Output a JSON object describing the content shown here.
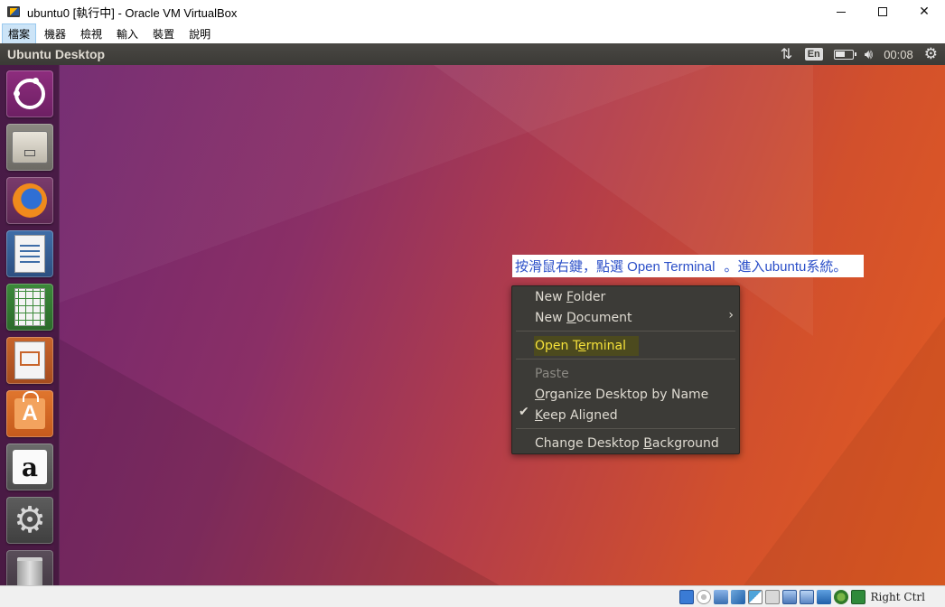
{
  "window": {
    "title": "ubuntu0 [執行中] - Oracle VM VirtualBox",
    "controls": {
      "minimize": "minimize",
      "maximize": "maximize",
      "close": "✕"
    }
  },
  "menubar": {
    "items": [
      "檔案",
      "機器",
      "檢視",
      "輸入",
      "裝置",
      "說明"
    ],
    "active_index": 0
  },
  "ubuntu_panel": {
    "title": "Ubuntu Desktop",
    "keyboard_layout": "En",
    "clock": "00:08"
  },
  "launcher": {
    "items": [
      {
        "name": "dash",
        "icon": "ubuntu-logo-icon"
      },
      {
        "name": "files",
        "icon": "file-cabinet-icon"
      },
      {
        "name": "firefox",
        "icon": "firefox-icon"
      },
      {
        "name": "libreoffice-writer",
        "icon": "writer-document-icon"
      },
      {
        "name": "libreoffice-calc",
        "icon": "calc-spreadsheet-icon"
      },
      {
        "name": "libreoffice-impress",
        "icon": "impress-presentation-icon"
      },
      {
        "name": "ubuntu-software",
        "icon": "shopping-bag-icon"
      },
      {
        "name": "amazon",
        "icon": "amazon-icon"
      },
      {
        "name": "system-settings",
        "icon": "gear-wrench-icon"
      },
      {
        "name": "trash",
        "icon": "trash-icon"
      }
    ],
    "amazon_glyph": "a",
    "software_glyph": "A"
  },
  "callout": {
    "text_before": "按滑鼠右鍵，點選 Open Terminal",
    "text_after": "。進入ubuntu系統。"
  },
  "context_menu": {
    "items": [
      {
        "pre": "New ",
        "mnemonic": "F",
        "post": "older",
        "disabled": false
      },
      {
        "pre": "New ",
        "mnemonic": "D",
        "post": "ocument",
        "disabled": false,
        "submenu": true
      },
      {
        "pre": "Open T",
        "mnemonic": "e",
        "post": "rminal",
        "disabled": false,
        "highlighted": true
      },
      {
        "pre": "Paste",
        "mnemonic": "",
        "post": "",
        "disabled": true
      },
      {
        "pre": "",
        "mnemonic": "O",
        "post": "rganize Desktop by Name",
        "disabled": false
      },
      {
        "pre": "",
        "mnemonic": "K",
        "post": "eep Aligned",
        "disabled": false,
        "checked": true
      },
      {
        "pre": "Change Desktop ",
        "mnemonic": "B",
        "post": "ackground",
        "disabled": false
      }
    ],
    "submenu_arrow": "›",
    "check_mark": "✔"
  },
  "statusbar": {
    "host_key": "Right Ctrl",
    "icons": [
      "hard-disk-icon",
      "optical-drive-icon",
      "audio-icon",
      "network-icon",
      "usb-icon",
      "shared-folder-icon",
      "display-icon",
      "video-capture-icon",
      "drag-drop-icon",
      "cpu-activity-icon",
      "mouse-integration-icon"
    ]
  },
  "colors": {
    "desktop_start": "#6c2570",
    "desktop_end": "#e35c21",
    "panel": "#3b3a36",
    "menu_bg": "#3c3b37",
    "highlight_text": "#f5e13a",
    "callout_text": "#2b4fc8"
  }
}
